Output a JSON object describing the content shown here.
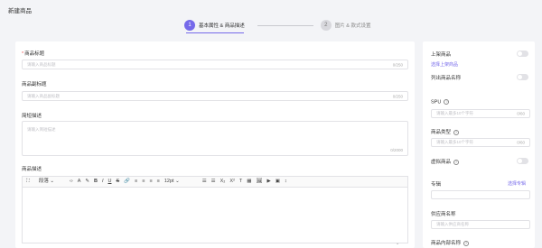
{
  "page": {
    "title": "新建商品"
  },
  "steps": [
    {
      "num": "1",
      "label": "基本属性 & 商品描述"
    },
    {
      "num": "2",
      "label": "图片 & 款式设置"
    }
  ],
  "form": {
    "product_title": {
      "label": "商品标题",
      "placeholder": "请输入商品标题",
      "count": "0/250"
    },
    "product_subtitle": {
      "label": "商品副标题",
      "placeholder": "请输入商品副标题",
      "count": "0/250"
    },
    "brief": {
      "label": "简短描述",
      "placeholder": "请输入简短描述",
      "count": "0/2000"
    },
    "description": {
      "label": "商品描述"
    }
  },
  "editor_toolbar": {
    "fullscreen_icon": "⛶",
    "paragraph": "段落",
    "code_icon": "‹›",
    "font_color_icon": "A",
    "highlight_icon": "✎",
    "bold": "B",
    "italic": "I",
    "underline": "U",
    "strike": "S",
    "link_icon": "🔗",
    "align_left_icon": "≡",
    "align_center_icon": "≡",
    "align_right_icon": "≡",
    "align_justify_icon": "≡",
    "font_size": "12pt",
    "bullet_list_icon": "☰",
    "numbered_list_icon": "☰",
    "subscript": "X₂",
    "superscript": "X²",
    "clear_format_icon": "T",
    "table_icon": "▦",
    "image_icon": "🖼",
    "video_icon": "▶",
    "emoji_icon": "▣",
    "line_height_icon": "↕"
  },
  "sidebar": {
    "on_shelf": {
      "label": "上架商品",
      "link": "选择上架商品"
    },
    "list_item": {
      "label": "列出商品名称"
    },
    "spu": {
      "label": "SPU",
      "placeholder": "请输入最多10个字符",
      "count": "0/60"
    },
    "product_type": {
      "label": "商品类型",
      "placeholder": "请输入最多10个字符",
      "count": "0/60"
    },
    "virtual": {
      "label": "虚拟商品"
    },
    "category": {
      "label": "专辑",
      "link": "选择专辑"
    },
    "supplier": {
      "label": "供应商名称",
      "placeholder": "请输入供应商名称"
    },
    "internal": {
      "label": "商品内部名称"
    }
  }
}
